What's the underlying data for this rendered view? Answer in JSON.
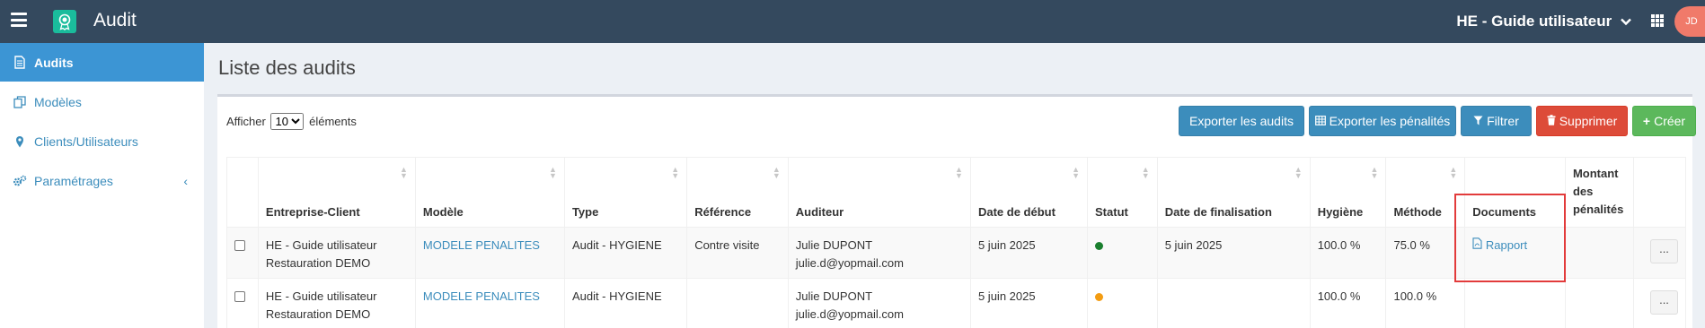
{
  "header": {
    "app_title": "Audit",
    "company": "HE - Guide utilisateur",
    "avatar_initials": "JD"
  },
  "sidebar": {
    "items": [
      {
        "label": "Audits",
        "icon": "file-icon",
        "active": true
      },
      {
        "label": "Modèles",
        "icon": "copy-icon"
      },
      {
        "label": "Clients/Utilisateurs",
        "icon": "map-pin-icon"
      },
      {
        "label": "Paramétrages",
        "icon": "cogs-icon",
        "caret": "‹"
      }
    ]
  },
  "main": {
    "title": "Liste des audits",
    "show_prefix": "Afficher",
    "show_value": "10",
    "show_suffix": "éléments",
    "buttons": {
      "export_audits": "Exporter les audits",
      "export_penalties": "Exporter les pénalités",
      "filter": "Filtrer",
      "delete": "Supprimer",
      "create": "Créer"
    }
  },
  "table": {
    "headers": {
      "client": "Entreprise-Client",
      "model": "Modèle",
      "type": "Type",
      "reference": "Référence",
      "auditor": "Auditeur",
      "start_date": "Date de début",
      "status": "Statut",
      "end_date": "Date de finalisation",
      "hygiene": "Hygiène",
      "method": "Méthode",
      "documents": "Documents",
      "penalties": "Montant des pénalités"
    },
    "rows": [
      {
        "client_1": "HE - Guide utilisateur",
        "client_2": "Restauration DEMO",
        "model": "MODELE PENALITES",
        "type": "Audit - HYGIENE",
        "reference": "Contre visite",
        "auditor_name": "Julie DUPONT",
        "auditor_email": "julie.d@yopmail.com",
        "start_date": "5 juin 2025",
        "status_color": "#1a7f2e",
        "end_date": "5 juin 2025",
        "hygiene": "100.0 %",
        "method": "75.0 %",
        "document": "Rapport",
        "penalties": "",
        "more": "..."
      },
      {
        "client_1": "HE - Guide utilisateur",
        "client_2": "Restauration DEMO",
        "model": "MODELE PENALITES",
        "type": "Audit - HYGIENE",
        "reference": "",
        "auditor_name": "Julie DUPONT",
        "auditor_email": "julie.d@yopmail.com",
        "start_date": "5 juin 2025",
        "status_color": "#f39c12",
        "end_date": "",
        "hygiene": "100.0 %",
        "method": "100.0 %",
        "document": "",
        "penalties": "",
        "more": "..."
      }
    ]
  }
}
